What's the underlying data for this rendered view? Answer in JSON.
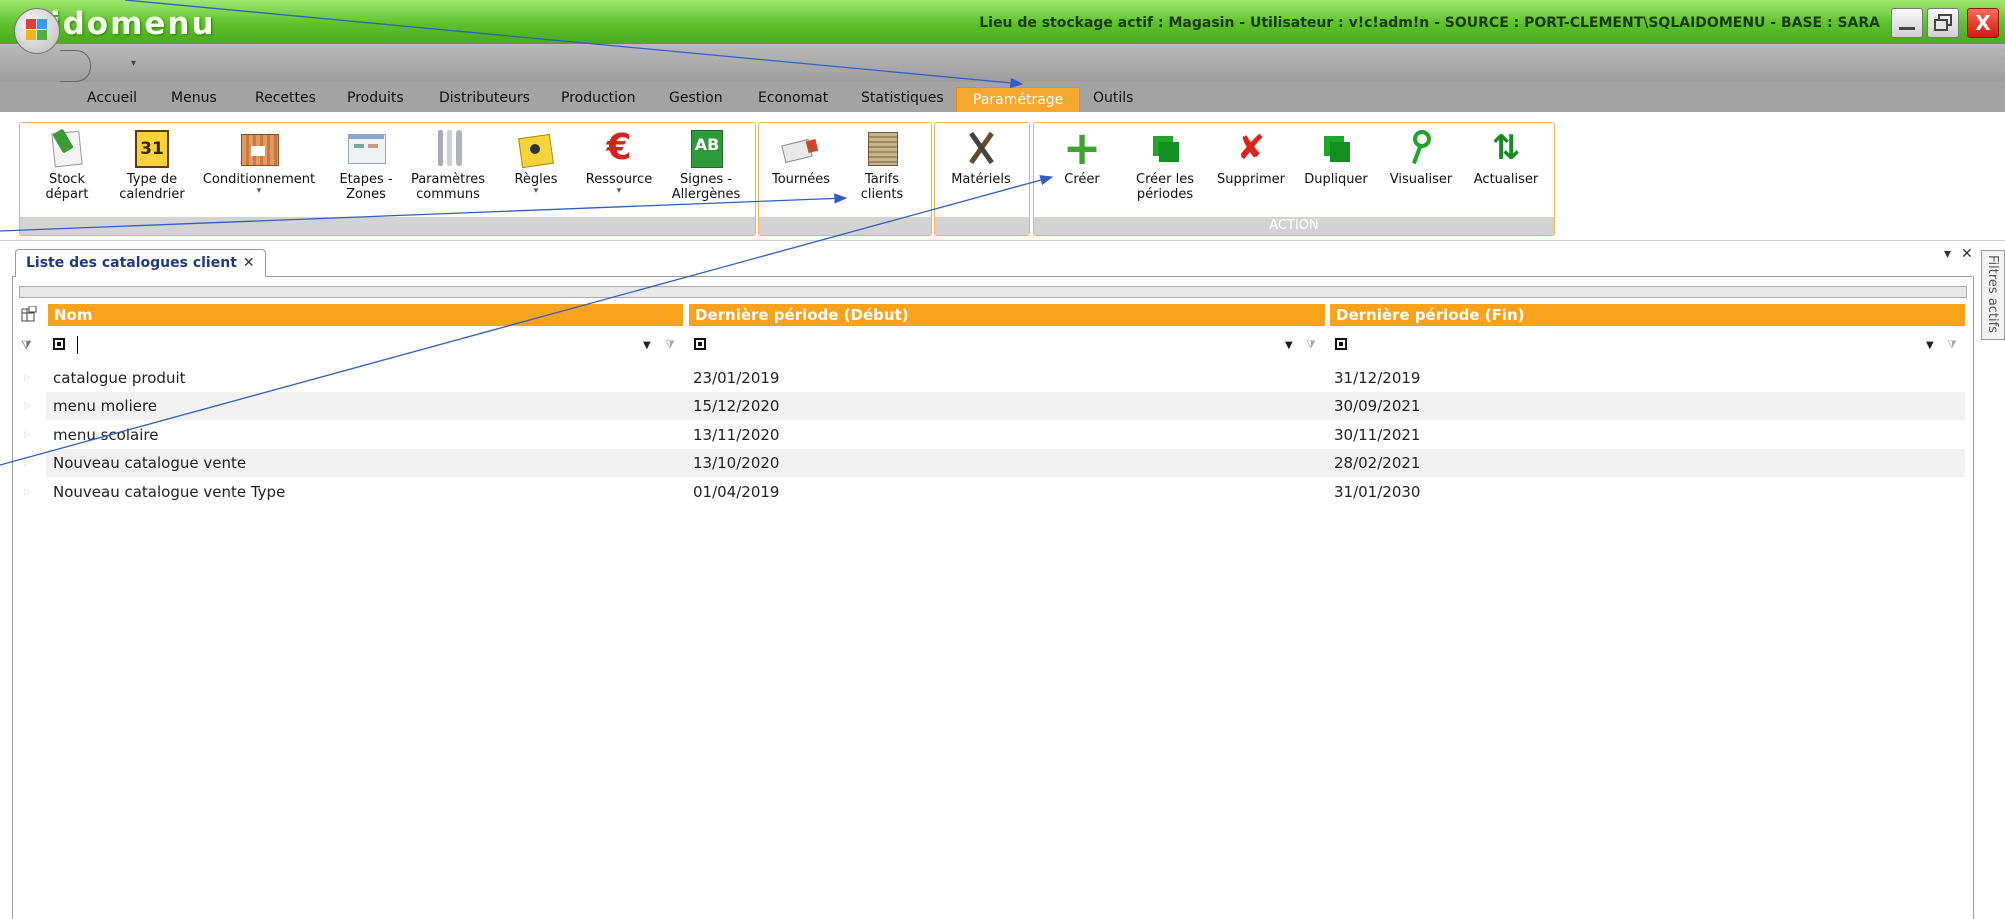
{
  "app": {
    "name": "Aidomenu",
    "status": "Lieu de stockage actif : Magasin - Utilisateur : v!c!adm!n - SOURCE : PORT-CLEMENT\\SQLAIDOMENU - BASE : SARA"
  },
  "window": {
    "close_label": "X"
  },
  "qa": {
    "dropdown": "▾"
  },
  "menu_tabs": [
    "Accueil",
    "Menus",
    "Recettes",
    "Produits",
    "Distributeurs",
    "Production",
    "Gestion",
    "Economat",
    "Statistiques",
    "Paramétrage",
    "Outils"
  ],
  "ribbon": {
    "buttons": [
      {
        "label": "Stock\ndépart",
        "icon": "stock-icon"
      },
      {
        "label": "Type de\ncalendrier",
        "icon": "calendar-icon",
        "icon_text": "31"
      },
      {
        "label": "Conditionnement",
        "icon": "packaging-icon"
      },
      {
        "label": "Etapes -\nZones",
        "icon": "steps-zones-icon"
      },
      {
        "label": "Paramètres\ncommuns",
        "icon": "cutlery-icon"
      },
      {
        "label": "Règles",
        "icon": "rules-icon"
      },
      {
        "label": "Ressource",
        "icon": "euro-icon",
        "icon_text": "€"
      },
      {
        "label": "Signes -\nAllergènes",
        "icon": "organic-label-icon",
        "icon_text": "AB"
      },
      {
        "label": "Tournées",
        "icon": "truck-icon"
      },
      {
        "label": "Tarifs\nclients",
        "icon": "price-list-icon"
      },
      {
        "label": "Matériels",
        "icon": "tools-icon"
      },
      {
        "label": "Créer",
        "icon": "plus-icon",
        "icon_text": "+"
      },
      {
        "label": "Créer les\npériodes",
        "icon": "copy-periods-icon"
      },
      {
        "label": "Supprimer",
        "icon": "delete-icon",
        "icon_text": "✘"
      },
      {
        "label": "Dupliquer",
        "icon": "duplicate-icon"
      },
      {
        "label": "Visualiser",
        "icon": "view-icon"
      },
      {
        "label": "Actualiser",
        "icon": "refresh-icon",
        "icon_text": "⇅"
      }
    ],
    "dropdown_marker": "▾",
    "action_group_label": "ACTION"
  },
  "document_tab": {
    "title": "Liste des catalogues client",
    "close": "✕"
  },
  "panel_controls": {
    "pin": "▾",
    "close": "✕"
  },
  "side_panel": {
    "label": "Filtres actifs"
  },
  "grid": {
    "columns": [
      "Nom",
      "Dernière période (Début)",
      "Dernière période (Fin)"
    ],
    "rows": [
      [
        "catalogue produit",
        "23/01/2019",
        "31/12/2019"
      ],
      [
        "menu moliere",
        "15/12/2020",
        "30/09/2021"
      ],
      [
        "menu scolaire",
        "13/11/2020",
        "30/11/2021"
      ],
      [
        "Nouveau catalogue vente",
        "13/10/2020",
        "28/02/2021"
      ],
      [
        "Nouveau catalogue vente Type",
        "01/04/2019",
        "31/01/2030"
      ]
    ]
  },
  "colors": {
    "accent": "#f9a21b",
    "titlebar": "#5cc12a",
    "annotation_arrows": "#2f5fc4"
  }
}
